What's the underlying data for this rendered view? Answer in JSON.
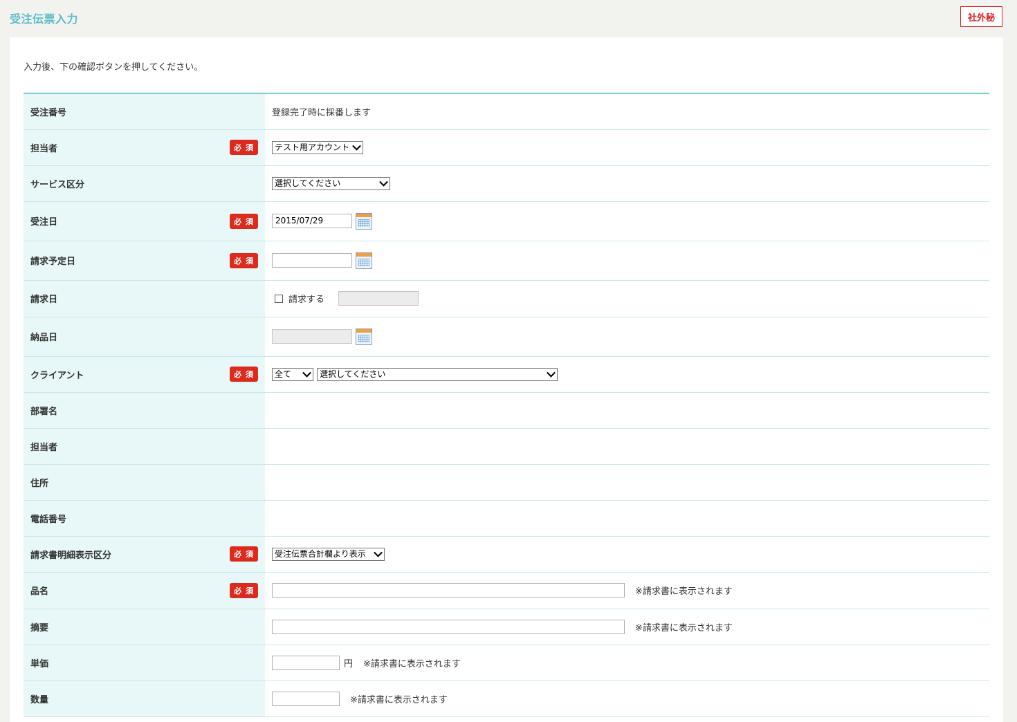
{
  "header": {
    "title": "受注伝票入力",
    "confidential": "社外秘"
  },
  "instruction": "入力後、下の確認ボタンを押してください。",
  "required_badge": "必 須",
  "form": {
    "order_number": {
      "label": "受注番号",
      "value": "登録完了時に採番します"
    },
    "staff": {
      "label": "担当者",
      "selected": "テスト用アカウント"
    },
    "service_category": {
      "label": "サービス区分",
      "selected": "選択してください"
    },
    "order_date": {
      "label": "受注日",
      "value": "2015/07/29"
    },
    "billing_scheduled_date": {
      "label": "請求予定日",
      "value": ""
    },
    "billing_date": {
      "label": "請求日",
      "checkbox_label": "請求する"
    },
    "delivery_date": {
      "label": "納品日"
    },
    "client": {
      "label": "クライアント",
      "filter_selected": "全て",
      "selected": "選択してください"
    },
    "department": {
      "label": "部署名"
    },
    "client_contact": {
      "label": "担当者"
    },
    "address": {
      "label": "住所"
    },
    "phone": {
      "label": "電話番号"
    },
    "invoice_detail_display": {
      "label": "請求書明細表示区分",
      "selected": "受注伝票合計欄より表示"
    },
    "item_name": {
      "label": "品名",
      "note": "※請求書に表示されます"
    },
    "summary": {
      "label": "摘要",
      "note": "※請求書に表示されます"
    },
    "unit_price": {
      "label": "単価",
      "unit": "円",
      "note": "※請求書に表示されます"
    },
    "quantity": {
      "label": "数量",
      "note": "※請求書に表示されます"
    }
  }
}
